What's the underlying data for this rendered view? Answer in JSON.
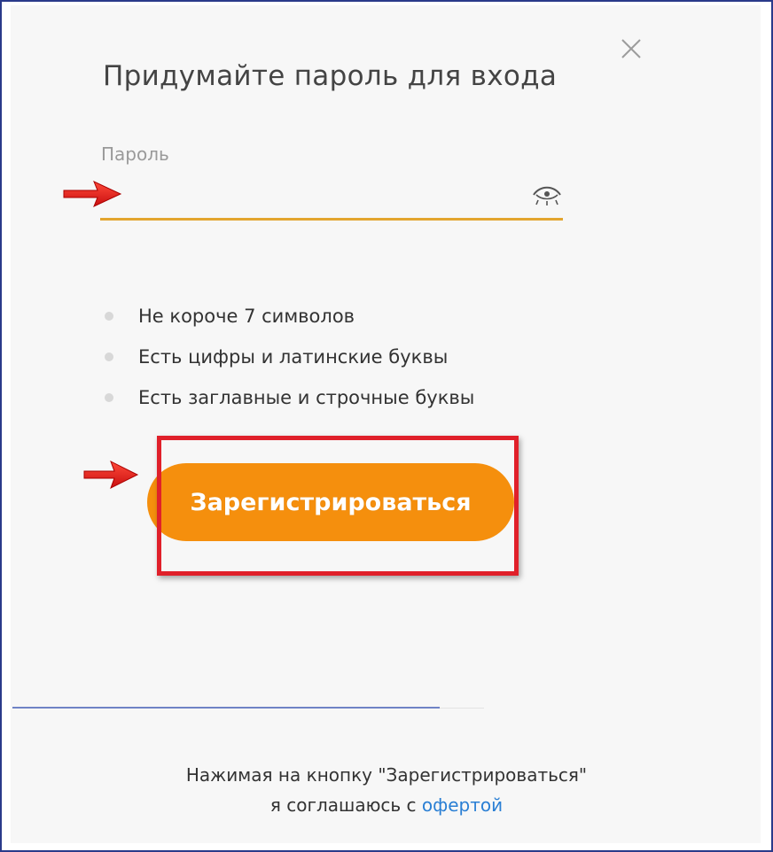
{
  "dialog": {
    "title": "Придумайте пароль для входа",
    "close_icon": "close-icon"
  },
  "password_field": {
    "label": "Пароль",
    "value": "",
    "placeholder": "",
    "visibility_icon": "eye-icon",
    "underline_color": "#e3a52f"
  },
  "requirements": [
    {
      "text": "Не короче 7 символов"
    },
    {
      "text": "Есть цифры и латинские буквы"
    },
    {
      "text": "Есть заглавные и строчные буквы"
    }
  ],
  "register_button": {
    "label": "Зарегистрироваться",
    "color": "#f58f0d"
  },
  "annotations": {
    "arrow_icon": "red-arrow-icon",
    "highlight_color": "#e0202a"
  },
  "footer": {
    "line1": "Нажимая на кнопку \"Зарегистрироваться\"",
    "line2_prefix": "я соглашаюсь с ",
    "offer_link": "офертой",
    "link_color": "#2a7fd4"
  }
}
